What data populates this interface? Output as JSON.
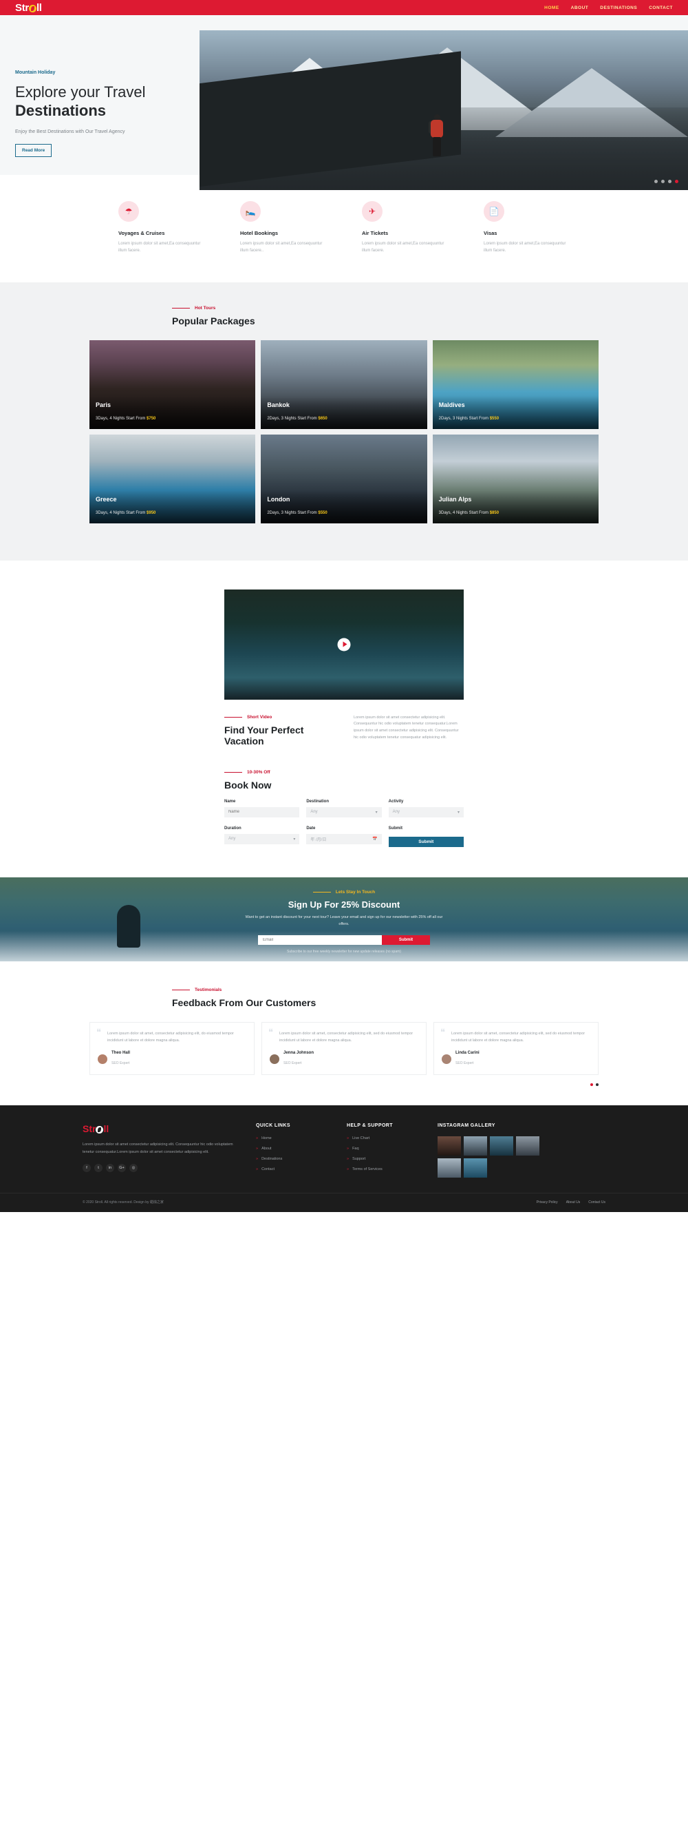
{
  "brand": {
    "name_a": "Str",
    "name_b": "ll",
    "icon": "globe-icon"
  },
  "nav": {
    "items": [
      "HOME",
      "ABOUT",
      "DESTINATIONS",
      "CONTACT"
    ]
  },
  "hero": {
    "eyebrow": "Mountain Holiday",
    "title_line1": "Explore your Travel",
    "title_line2": "Destinations",
    "subtitle": "Enjoy the Best Destinations with Our Travel Agency",
    "button": "Read More",
    "slides": 4,
    "active_slide": 3
  },
  "services": [
    {
      "icon": "globe-icon",
      "title": "Voyages & Cruises",
      "desc": "Lorem ipsum dolor sit amet,Ea consequuntur illum facere."
    },
    {
      "icon": "bed-icon",
      "title": "Hotel Bookings",
      "desc": "Lorem ipsum dolor sit amet,Ea consequuntur illum facere.."
    },
    {
      "icon": "plane-icon",
      "title": "Air Tickets",
      "desc": "Lorem ipsum dolor sit amet,Ea consequuntur illum facere."
    },
    {
      "icon": "document-icon",
      "title": "Visas",
      "desc": "Lorem ipsum dolor sit amet,Ea consequuntur illum facere."
    }
  ],
  "packages": {
    "label": "Hot Tours",
    "title": "Popular Packages",
    "row1": [
      {
        "city": "Paris",
        "detail": "3Days, 4 Nights Start From ",
        "price": "$750",
        "bg": "bg-paris"
      },
      {
        "city": "Bankok",
        "detail": "2Days, 3 Nights Start From ",
        "price": "$650",
        "bg": "bg-bankok"
      },
      {
        "city": "Maldives",
        "detail": "2Days, 3 Nights Start From ",
        "price": "$550",
        "bg": "bg-maldives"
      }
    ],
    "row2": [
      {
        "city": "Greece",
        "detail": "3Days, 4 Nights Start From ",
        "price": "$950",
        "bg": "bg-greece"
      },
      {
        "city": "London",
        "detail": "2Days, 3 Nights Start From ",
        "price": "$550",
        "bg": "bg-london"
      },
      {
        "city": "Julian Alps",
        "detail": "3Days, 4 Nights Start From ",
        "price": "$850",
        "bg": "bg-alps"
      }
    ]
  },
  "video": {
    "play_icon": "play-icon",
    "label": "Short Video",
    "title": "Find Your Perfect Vacation",
    "desc": "Lorem ipsum dolor sit amet consectetur adipisicing elit. Consequuntur hic odio voluptatem tenetur consequatur.Lorem ipsum dolor sit amet consectetur adipisicing elit. Consequuntur hic odio voluptatem tenetur consequatur adipisicing elit."
  },
  "book": {
    "label": "10-30% Off",
    "title": "Book Now",
    "fields": [
      {
        "label": "Name",
        "value": "Name",
        "type": "text"
      },
      {
        "label": "Destination",
        "value": "Any",
        "type": "select"
      },
      {
        "label": "Activity",
        "value": "Any",
        "type": "select"
      },
      {
        "label": "Duration",
        "value": "Any",
        "type": "select"
      },
      {
        "label": "Date",
        "value": "年 /月/日",
        "type": "date"
      },
      {
        "label": "Submit",
        "value": "Submit",
        "type": "button"
      }
    ]
  },
  "signup": {
    "label": "Lets Stay In Touch",
    "title": "Sign Up For 25% Discount",
    "desc": "Want to get an instant discount for your next tour? Leave your email and sign up for our newsletter with 25% off all our offers.",
    "email_placeholder": "Email",
    "button": "Submit",
    "note": "Subscribe to our free weekly newsletter for new update releases (no spam)"
  },
  "testimonials": {
    "label": "Testimonials",
    "title": "Feedback From Our Customers",
    "items": [
      {
        "quote": "Lorem ipsum dolor sit amet, consectetur adipisicing elit, do eiusmod tempor incididunt ut labore et dolore magna aliqua.",
        "name": "Theo Hall",
        "role": "SEO Expert"
      },
      {
        "quote": "Lorem ipsum dolor sit amet, consectetur adipisicing elit, sed do eiusmod tempor incididunt ut labore et dolore magna aliqua.",
        "name": "Jenna Johnson",
        "role": "SEO Expert"
      },
      {
        "quote": "Lorem ipsum dolor sit amet, consectetur adipisicing elit, sed do eiusmod tempor incididunt ut labore et dolore magna aliqua.",
        "name": "Linda Carini",
        "role": "SEO Expert"
      }
    ]
  },
  "footer": {
    "about": "Lorem ipsum dolor sit amet consectetur adipisicing elit. Consequuntur hic odio voluptatem tenetur consequatur.Lorem ipsum dolor sit amet consectetur adipisicing elit.",
    "socials": [
      "f",
      "t",
      "in",
      "G+",
      "◎"
    ],
    "quick_links_title": "QUICK LINKS",
    "quick_links": [
      "Home",
      "About",
      "Destinations",
      "Contact"
    ],
    "help_title": "HELP & SUPPORT",
    "help_links": [
      "Live Chart",
      "Faq",
      "Support",
      "Terms of Services"
    ],
    "gallery_title": "INSTAGRAM GALLERY",
    "copyright": "© 2020 Stroll. All rights reserved. Design by 蜡烛之家",
    "bottom_links": [
      "Privacy Policy",
      "About Us",
      "Contact Us"
    ]
  }
}
